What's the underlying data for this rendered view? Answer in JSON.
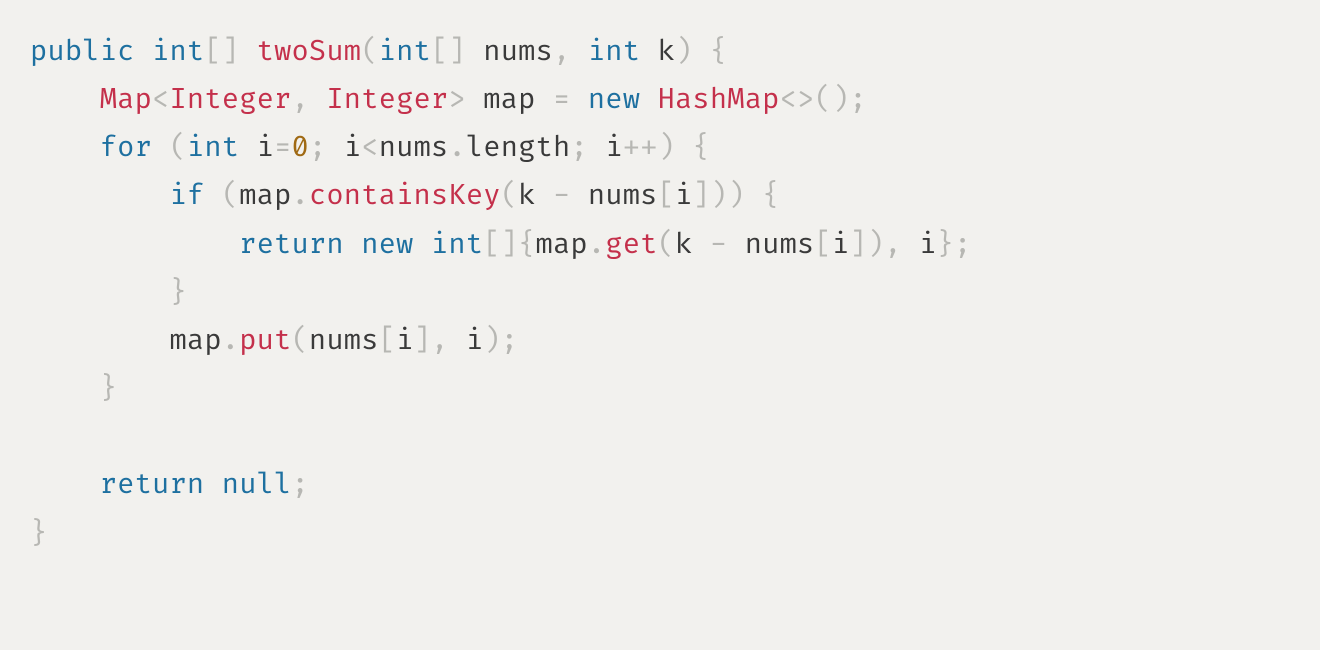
{
  "code": {
    "line1": {
      "kw_public": "public",
      "kw_int": "int",
      "br_open": "[]",
      "fn_twoSum": "twoSum",
      "paren_open": "(",
      "kw_int2": "int",
      "br_open2": "[]",
      "id_nums": " nums",
      "comma": ",",
      "kw_int3": " int",
      "id_k": " k",
      "paren_close": ")",
      "brace_open": " {"
    },
    "line2": {
      "indent": "    ",
      "type_Map": "Map",
      "lt": "<",
      "type_Integer1": "Integer",
      "comma": ",",
      "type_Integer2": " Integer",
      "gt": ">",
      "id_map": " map ",
      "eq": "=",
      "kw_new": " new",
      "type_HashMap": " HashMap",
      "diamond": "<>()",
      "semi": ";"
    },
    "line3": {
      "indent": "    ",
      "kw_for": "for",
      "paren_open": " (",
      "kw_int": "int",
      "id_i": " i",
      "eq": "=",
      "num_0": "0",
      "semi1": ";",
      "id_i2": " i",
      "lt": "<",
      "id_nums": "nums",
      "dot": ".",
      "id_length": "length",
      "semi2": ";",
      "id_i3": " i",
      "inc": "++",
      "paren_close": ")",
      "brace_open": " {"
    },
    "line4": {
      "indent": "        ",
      "kw_if": "if",
      "paren_open": " (",
      "id_map": "map",
      "dot": ".",
      "fn_containsKey": "containsKey",
      "paren_open2": "(",
      "id_k": "k ",
      "minus": "-",
      "id_nums": " nums",
      "br_open": "[",
      "id_i": "i",
      "br_close": "]))",
      "brace_open": " {"
    },
    "line5": {
      "indent": "            ",
      "kw_return": "return",
      "kw_new": " new",
      "kw_int": " int",
      "br": "[]{",
      "id_map": "map",
      "dot": ".",
      "fn_get": "get",
      "paren_open": "(",
      "id_k": "k ",
      "minus": "-",
      "id_nums": " nums",
      "br_open": "[",
      "id_i": "i",
      "br_close": "]),",
      "id_i2": " i",
      "brace_close": "};"
    },
    "line6": {
      "indent": "        ",
      "brace_close": "}"
    },
    "line7": {
      "indent": "        ",
      "id_map": "map",
      "dot": ".",
      "fn_put": "put",
      "paren_open": "(",
      "id_nums": "nums",
      "br_open": "[",
      "id_i": "i",
      "br_close": "],",
      "id_i2": " i",
      "paren_close": ");"
    },
    "line8": {
      "indent": "    ",
      "brace_close": "}"
    },
    "blank": " ",
    "line9": {
      "indent": "    ",
      "kw_return": "return",
      "kw_null": " null",
      "semi": ";"
    },
    "line10": {
      "brace_close": "}"
    }
  }
}
